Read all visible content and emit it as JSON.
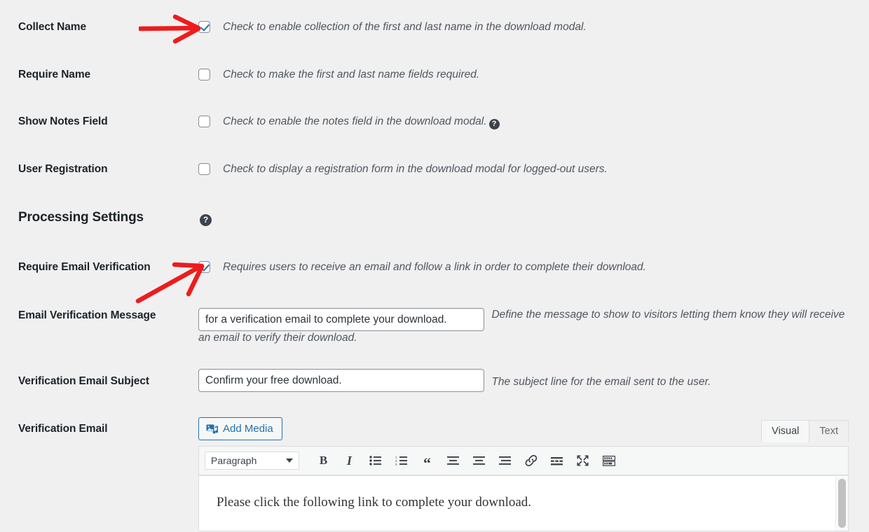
{
  "rows": [
    {
      "label": "Collect Name",
      "description": "Check to enable collection of the first and last name in the download modal.",
      "checked": true
    },
    {
      "label": "Require Name",
      "description": "Check to make the first and last name fields required.",
      "checked": false
    },
    {
      "label": "Show Notes Field",
      "description": "Check to enable the notes field in the download modal.",
      "checked": false,
      "help": "?"
    },
    {
      "label": "User Registration",
      "description": "Check to display a registration form in the download modal for logged-out users.",
      "checked": false
    }
  ],
  "section": {
    "heading": "Processing Settings",
    "help": "?"
  },
  "email_verification": {
    "label": "Require Email Verification",
    "description": "Requires users to receive an email and follow a link in order to complete their download.",
    "checked": true
  },
  "verification_message": {
    "label": "Email Verification Message",
    "value": "for a verification email to complete your download.",
    "placeholder": "",
    "description": "Define the message to show to visitors letting them know they will receive an email to verify their download."
  },
  "verification_subject": {
    "label": "Verification Email Subject",
    "value": "Confirm your free download.",
    "placeholder": "",
    "description": "The subject line for the email sent to the user."
  },
  "verification_email": {
    "label": "Verification Email",
    "add_media_label": "Add Media",
    "tabs": [
      {
        "label": "Visual",
        "active": true
      },
      {
        "label": "Text",
        "active": false
      }
    ],
    "format_select": "Paragraph",
    "toolbar_icons": [
      "bold-icon",
      "italic-icon",
      "bulleted-list-icon",
      "numbered-list-icon",
      "blockquote-icon",
      "align-left-icon",
      "align-center-icon",
      "align-right-icon",
      "link-icon",
      "insert-more-icon",
      "fullscreen-icon",
      "toolbar-toggle-icon"
    ],
    "content": "Please click the following link to complete your download."
  },
  "colors": {
    "background": "#f0f0f1",
    "label_text": "#1d2327",
    "description_text": "#50575e",
    "accent_blue": "#2271b1",
    "annotation_red": "#ee1c1c",
    "checkbox_border": "#8c8f94"
  },
  "annotations": [
    {
      "name": "arrow-to-collect-name-checkbox",
      "target": "collect-name-checkbox"
    },
    {
      "name": "arrow-to-require-email-verification-checkbox",
      "target": "require-email-verification-checkbox"
    }
  ]
}
